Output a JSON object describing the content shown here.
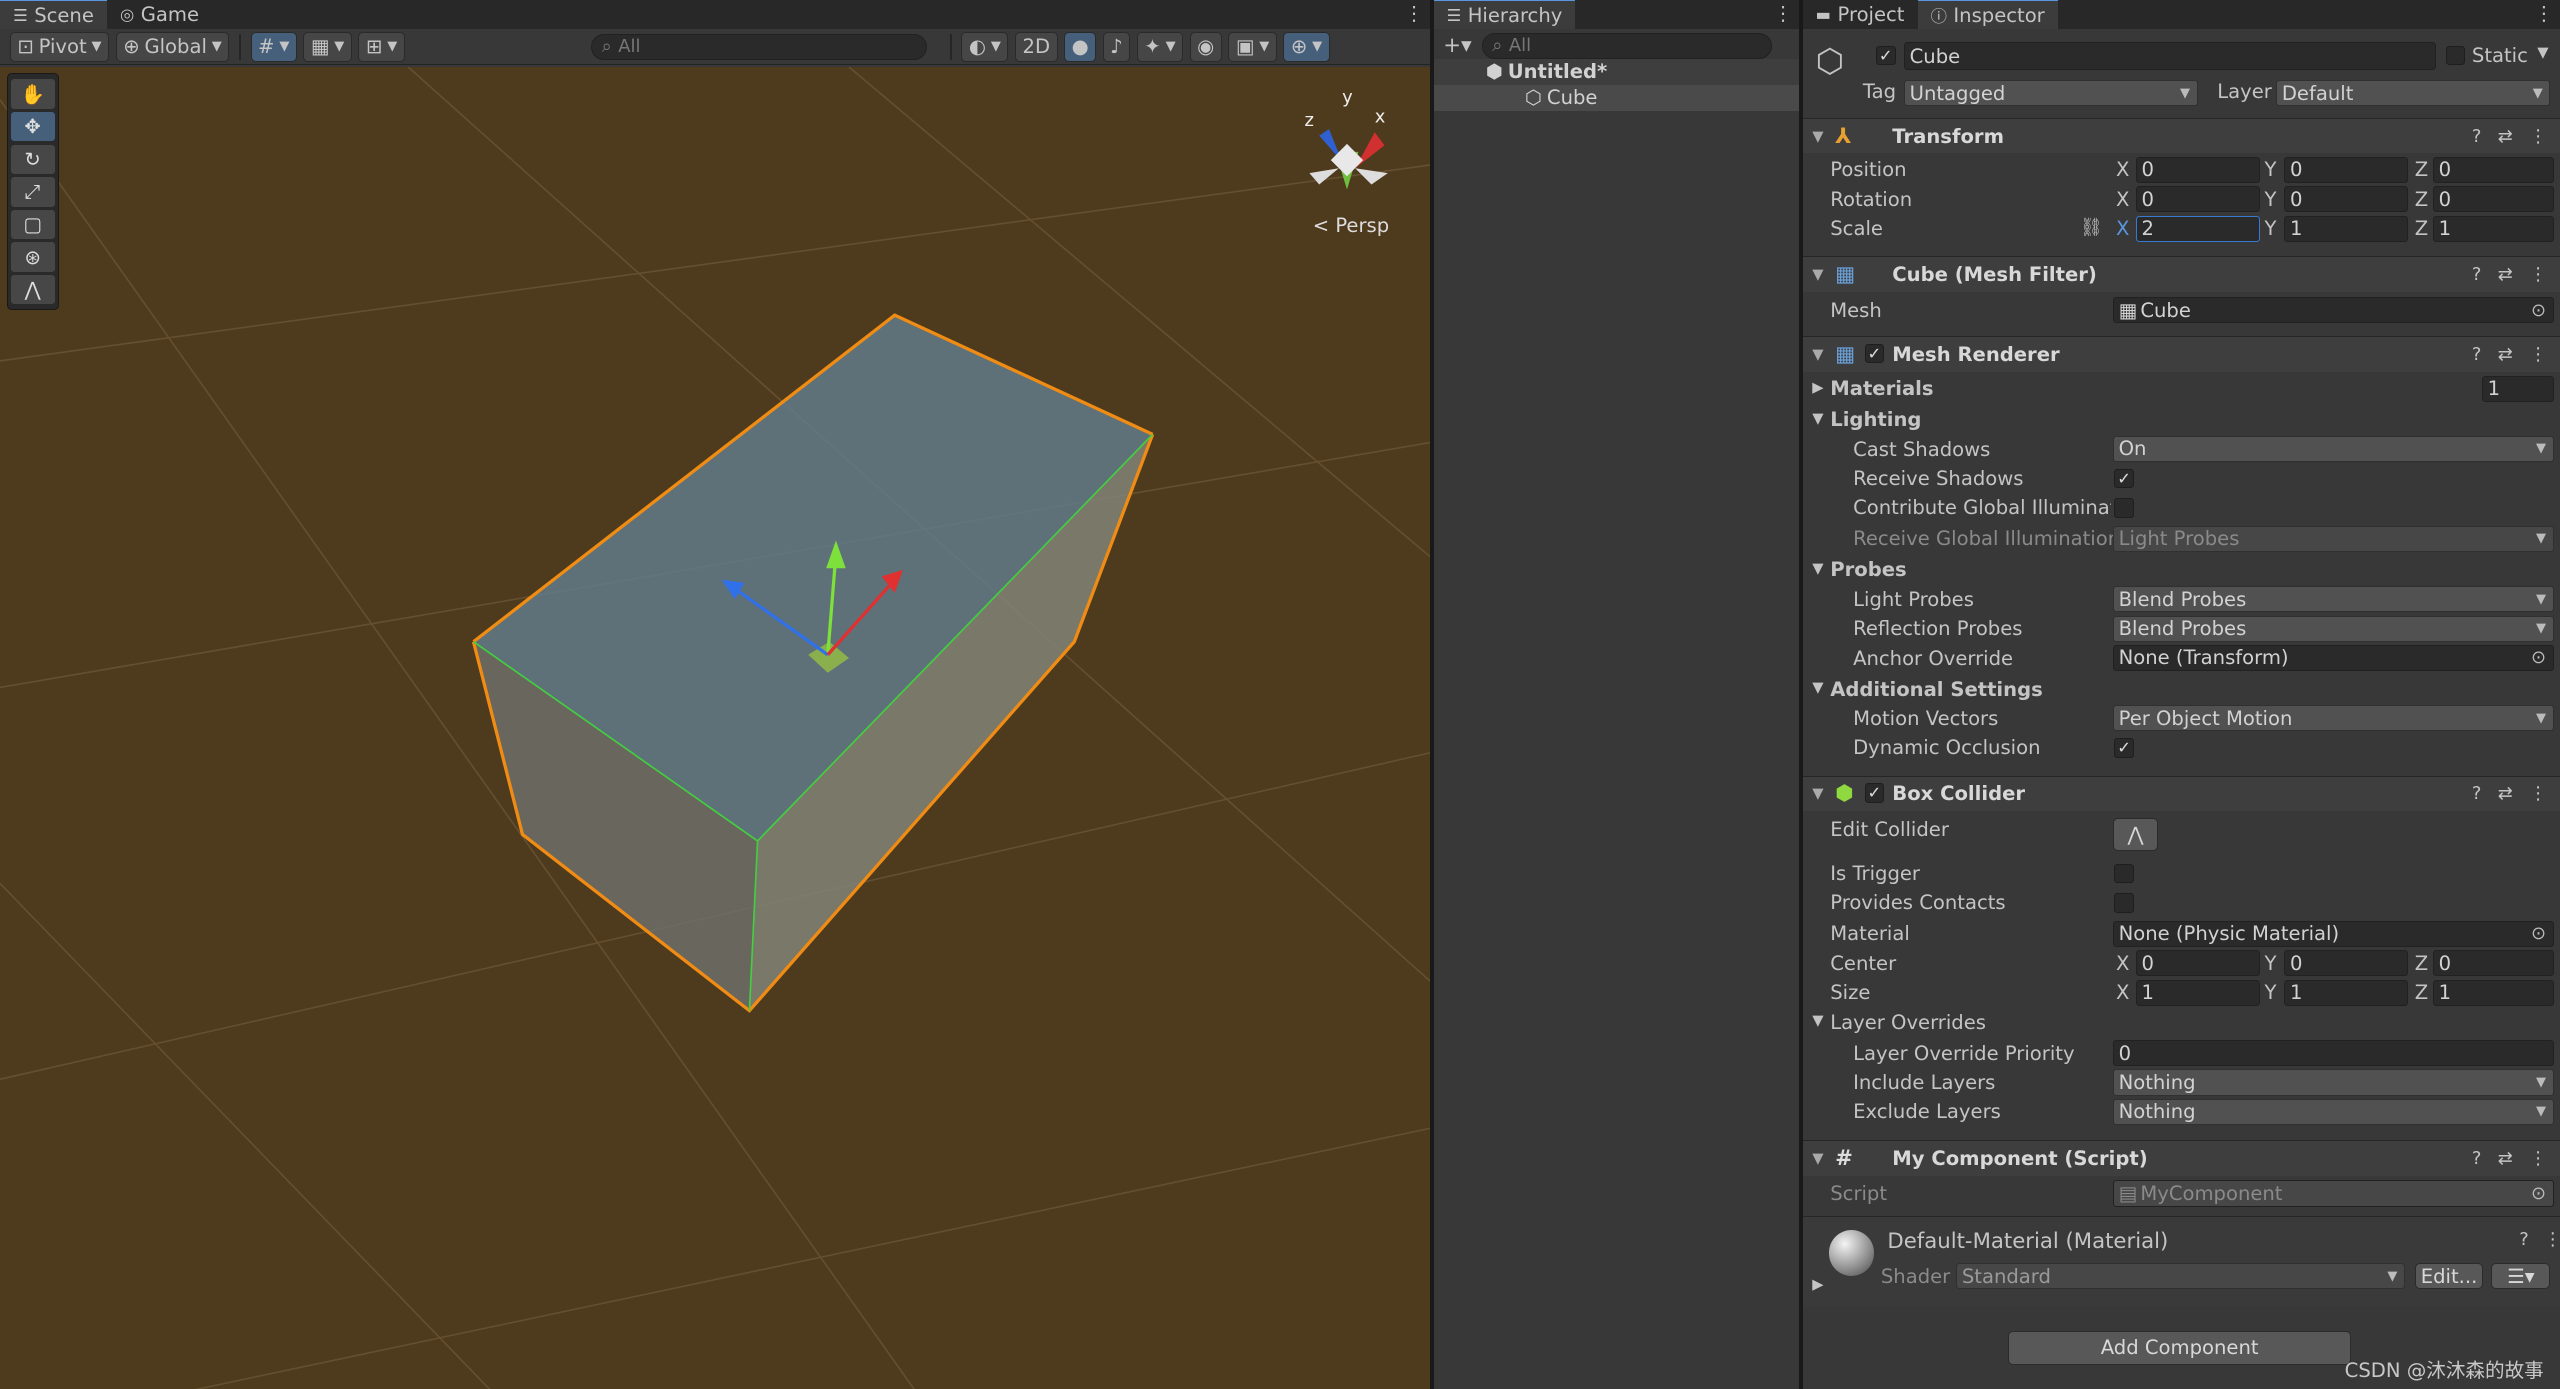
{
  "scene_tabs": {
    "scene": "Scene",
    "game": "Game"
  },
  "scene_toolbar": {
    "pivot": "Pivot",
    "global": "Global",
    "search_placeholder": "All",
    "mode_2d": "2D"
  },
  "gizmo": {
    "y": "y",
    "x": "x",
    "z": "z",
    "persp": "Persp"
  },
  "hierarchy": {
    "tab": "Hierarchy",
    "search_placeholder": "All",
    "scene_name": "Untitled*",
    "object": "Cube"
  },
  "inspector_tabs": {
    "project": "Project",
    "inspector": "Inspector"
  },
  "object": {
    "name": "Cube",
    "static_label": "Static",
    "tag_label": "Tag",
    "tag_value": "Untagged",
    "layer_label": "Layer",
    "layer_value": "Default"
  },
  "transform": {
    "title": "Transform",
    "position_label": "Position",
    "rotation_label": "Rotation",
    "scale_label": "Scale",
    "position": [
      "0",
      "0",
      "0"
    ],
    "rotation": [
      "0",
      "0",
      "0"
    ],
    "scale": [
      "2",
      "1",
      "1"
    ]
  },
  "axes": {
    "x": "X",
    "y": "Y",
    "z": "Z"
  },
  "mesh_filter": {
    "title": "Cube (Mesh Filter)",
    "mesh_label": "Mesh",
    "mesh_value": "Cube"
  },
  "mesh_renderer": {
    "title": "Mesh Renderer",
    "materials": "Materials",
    "materials_count": "1",
    "lighting": "Lighting",
    "cast_shadows": "Cast Shadows",
    "cast_shadows_value": "On",
    "receive_shadows": "Receive Shadows",
    "contribute_gi": "Contribute Global Illumination",
    "receive_gi": "Receive Global Illumination",
    "receive_gi_value": "Light Probes",
    "probes": "Probes",
    "light_probes": "Light Probes",
    "light_probes_value": "Blend Probes",
    "reflection_probes": "Reflection Probes",
    "reflection_probes_value": "Blend Probes",
    "anchor_override": "Anchor Override",
    "anchor_override_value": "None (Transform)",
    "additional": "Additional Settings",
    "motion_vectors": "Motion Vectors",
    "motion_vectors_value": "Per Object Motion",
    "dynamic_occlusion": "Dynamic Occlusion"
  },
  "box_collider": {
    "title": "Box Collider",
    "edit_collider": "Edit Collider",
    "is_trigger": "Is Trigger",
    "provides_contacts": "Provides Contacts",
    "material": "Material",
    "material_value": "None (Physic Material)",
    "center": "Center",
    "center_values": [
      "0",
      "0",
      "0"
    ],
    "size": "Size",
    "size_values": [
      "1",
      "1",
      "1"
    ],
    "layer_overrides": "Layer Overrides",
    "priority": "Layer Override Priority",
    "priority_value": "0",
    "include_layers": "Include Layers",
    "include_value": "Nothing",
    "exclude_layers": "Exclude Layers",
    "exclude_value": "Nothing"
  },
  "my_component": {
    "title": "My Component (Script)",
    "script_label": "Script",
    "script_value": "MyComponent"
  },
  "material": {
    "title": "Default-Material (Material)",
    "shader_label": "Shader",
    "shader_value": "Standard",
    "edit": "Edit..."
  },
  "add_component": "Add Component",
  "watermark": "CSDN @沐沐森的故事",
  "colors": {
    "viewport": "#4e3a1c",
    "accent": "#46607c",
    "selection_outline": "#f08c14"
  }
}
